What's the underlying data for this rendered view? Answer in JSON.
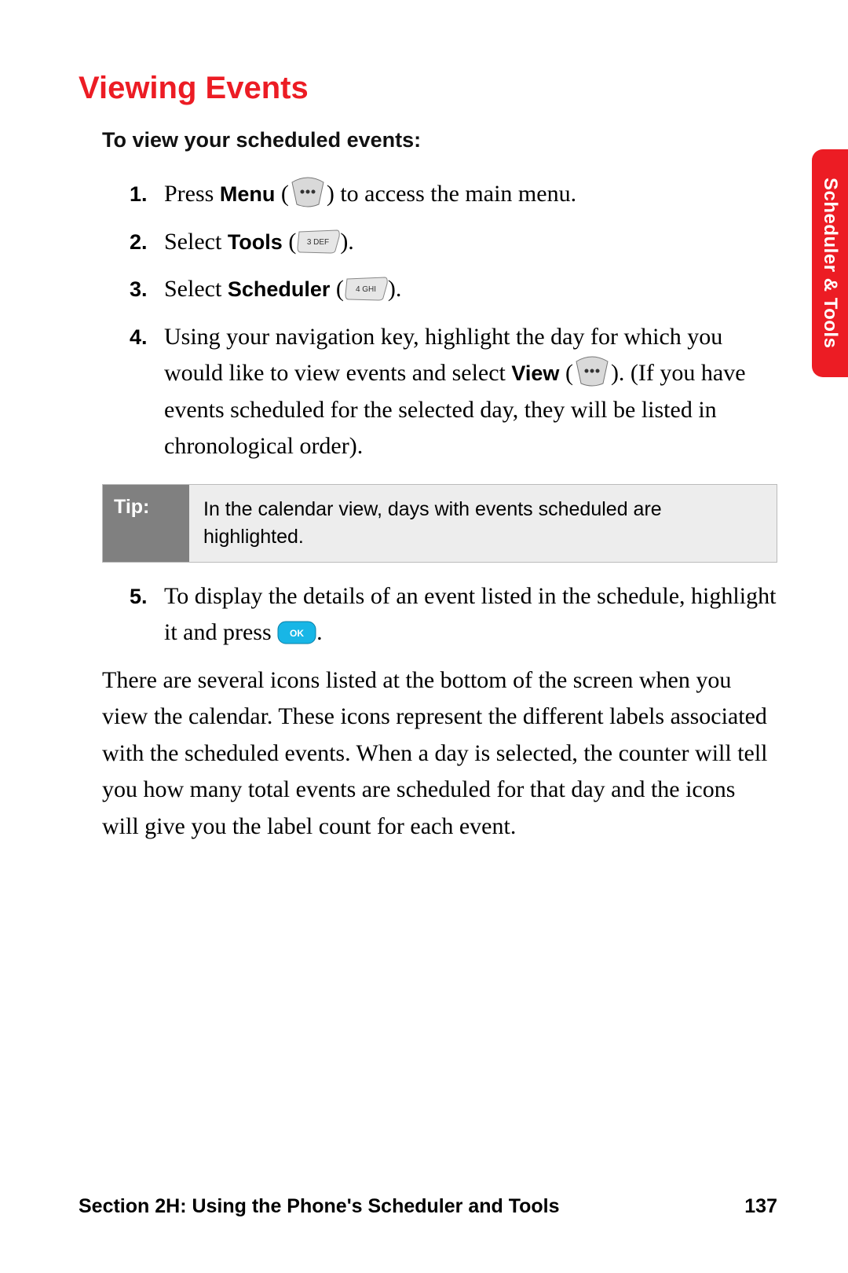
{
  "heading": "Viewing Events",
  "subheading": "To view your scheduled events:",
  "tab_label": "Scheduler & Tools",
  "steps": {
    "s1_num": "1.",
    "s1_a": "Press ",
    "s1_b": "Menu",
    "s1_c": " (",
    "s1_d": ") to access the main menu.",
    "s2_num": "2.",
    "s2_a": "Select ",
    "s2_b": "Tools",
    "s2_c": " (",
    "s2_d": ").",
    "s3_num": "3.",
    "s3_a": "Select ",
    "s3_b": "Scheduler",
    "s3_c": " (",
    "s3_d": ").",
    "s4_num": "4.",
    "s4_a": "Using your navigation key, highlight the day for which you would like to view events and select ",
    "s4_b": "View",
    "s4_c": " (",
    "s4_d": "). (If you have events scheduled for the selected day, they will be listed in chronological order).",
    "s5_num": "5.",
    "s5_a": "To display the details of an event listed in the schedule, highlight it and press ",
    "s5_b": "."
  },
  "tip_label": "Tip:",
  "tip_text": "In the calendar view, days with events scheduled are highlighted.",
  "paragraph": "There are several icons listed at the bottom of the screen when you view the calendar. These icons represent the different labels associated with the scheduled events. When a day is selected, the counter will tell you how many total events are scheduled for that day and the icons will give you the label count for each event.",
  "footer_section": "Section 2H: Using the Phone's Scheduler and Tools",
  "footer_page": "137",
  "key3_label": "3 DEF",
  "key4_label": "4 GHI",
  "ok_label": "OK"
}
